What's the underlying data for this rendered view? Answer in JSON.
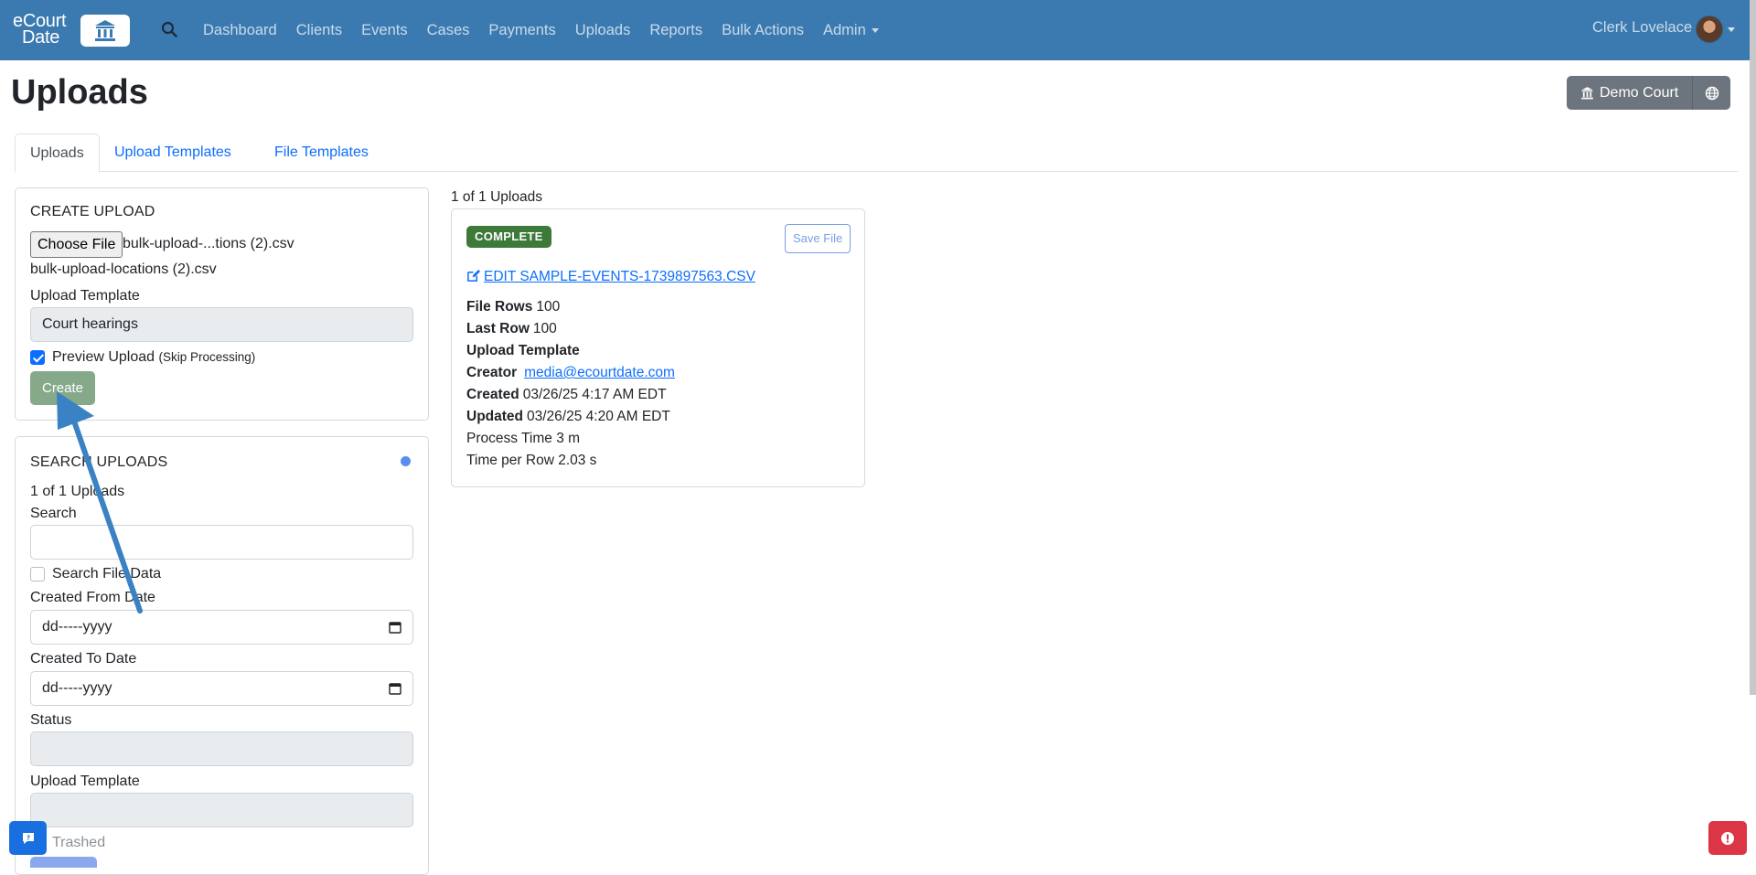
{
  "brand": {
    "line1": "eCourt",
    "line2": "Date"
  },
  "nav": {
    "links": [
      "Dashboard",
      "Clients",
      "Events",
      "Cases",
      "Payments",
      "Uploads",
      "Reports",
      "Bulk Actions",
      "Admin"
    ],
    "user_name": "Clerk Lovelace"
  },
  "page": {
    "title": "Uploads",
    "court_button": "Demo Court"
  },
  "tabs": [
    "Uploads",
    "Upload Templates",
    "File Templates"
  ],
  "create_upload": {
    "title": "CREATE UPLOAD",
    "choose_file_label": "Choose File",
    "chosen_file_short": "bulk-upload-...tions (2).csv",
    "chosen_file_full": "bulk-upload-locations (2).csv",
    "template_label": "Upload Template",
    "template_value": "Court hearings",
    "preview_label": "Preview Upload",
    "preview_note": "(Skip Processing)",
    "preview_checked": true,
    "create_button": "Create"
  },
  "search_uploads": {
    "title": "SEARCH UPLOADS",
    "count": "1 of 1 Uploads",
    "search_label": "Search",
    "search_value": "",
    "search_file_data_label": "Search File Data",
    "created_from_label": "Created From Date",
    "created_from_placeholder": "dd-----yyyy",
    "created_to_label": "Created To Date",
    "created_to_placeholder": "dd-----yyyy",
    "status_label": "Status",
    "template_label": "Upload Template",
    "trashed_label": "Trashed"
  },
  "results": {
    "count": "1 of 1 Uploads",
    "upload": {
      "status": "COMPLETE",
      "save_file": "Save File",
      "edit_link": "EDIT SAMPLE-EVENTS-1739897563.CSV",
      "file_rows_label": "File Rows",
      "file_rows": "100",
      "last_row_label": "Last Row",
      "last_row": "100",
      "template_label": "Upload Template",
      "creator_label": "Creator",
      "creator": "media@ecourtdate.com",
      "created_label": "Created",
      "created": "03/26/25 4:17 AM EDT",
      "updated_label": "Updated",
      "updated": "03/26/25 4:20 AM EDT",
      "process_time": "Process Time 3 m",
      "time_per_row": "Time per Row 2.03 s"
    }
  },
  "colors": {
    "navbar": "#3b7ab0",
    "complete_badge": "#3d7a3a",
    "create_button": "#86a98a",
    "annotation_arrow": "#3a82c4",
    "alert_button": "#dc3545",
    "chat_button": "#1a6fe0"
  },
  "icons": {
    "search": "search-icon",
    "court": "bank-icon",
    "globe": "globe-icon",
    "edit": "edit-icon",
    "calendar": "calendar-icon",
    "chat": "chat-icon",
    "alert": "alert-icon"
  }
}
